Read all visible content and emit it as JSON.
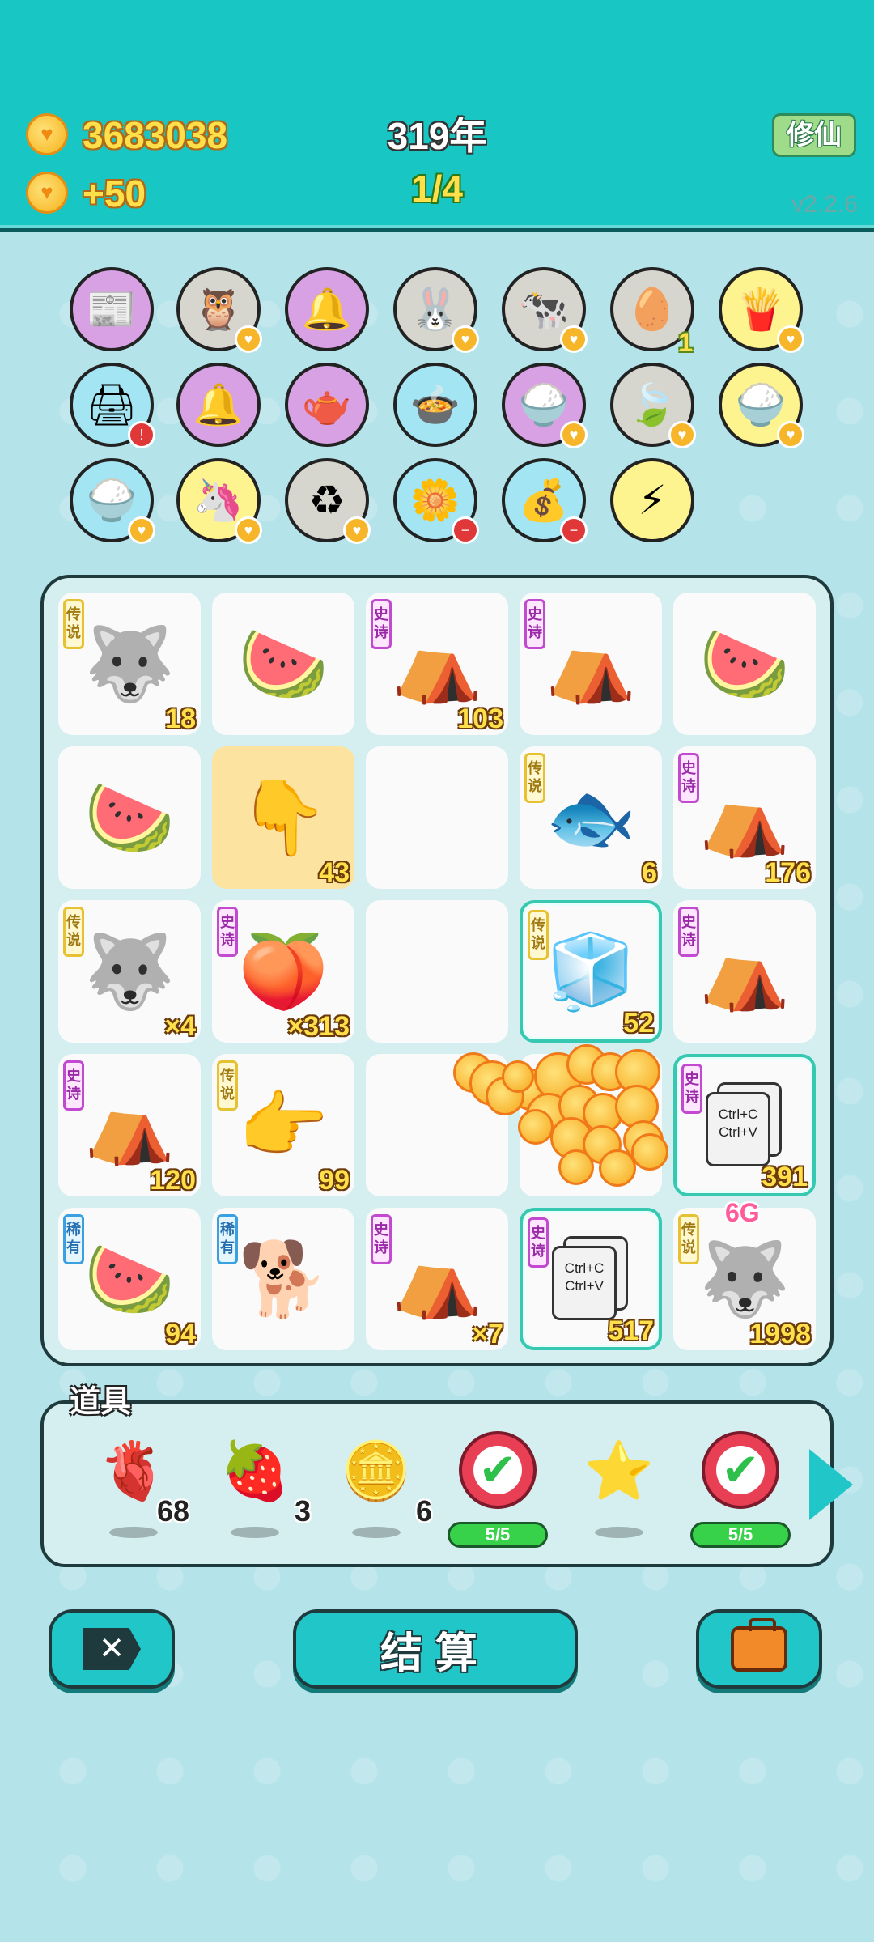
{
  "header": {
    "coins": "3683038",
    "income": "+50",
    "year": "319年",
    "progress": "1/4",
    "mode_button": "修仙",
    "version": "v2.2.6"
  },
  "buffs": [
    {
      "icon": "time-magazine-icon",
      "glyph": "📰",
      "bg": "purple",
      "badge": ""
    },
    {
      "icon": "owl-glasses-icon",
      "glyph": "🦉",
      "bg": "grey",
      "badge": "coin"
    },
    {
      "icon": "bell-icon",
      "glyph": "🔔",
      "bg": "purple",
      "badge": ""
    },
    {
      "icon": "rabbit-icon",
      "glyph": "🐰",
      "bg": "grey",
      "badge": "coin"
    },
    {
      "icon": "cows-icon",
      "glyph": "🐄",
      "bg": "grey",
      "badge": "coin"
    },
    {
      "icon": "egg-tray-icon",
      "glyph": "🥚",
      "bg": "grey",
      "badge": "",
      "count": "1"
    },
    {
      "icon": "fries-icon",
      "glyph": "🍟",
      "bg": "yellow",
      "badge": "coin"
    },
    {
      "icon": "printer-icon",
      "glyph": "🖨",
      "bg": "blue",
      "badge": "warn"
    },
    {
      "icon": "bell-icon",
      "glyph": "🔔",
      "bg": "purple",
      "badge": ""
    },
    {
      "icon": "gravy-boat-icon",
      "glyph": "🫖",
      "bg": "purple",
      "badge": ""
    },
    {
      "icon": "pot-duck-icon",
      "glyph": "🍲",
      "bg": "blue",
      "badge": ""
    },
    {
      "icon": "rice-bowl-icon",
      "glyph": "🍚",
      "bg": "purple",
      "badge": "coin"
    },
    {
      "icon": "leaf-icon",
      "glyph": "🍃",
      "bg": "grey",
      "badge": "coin"
    },
    {
      "icon": "rice-bowl-icon",
      "glyph": "🍚",
      "bg": "yellow",
      "badge": "coin"
    },
    {
      "icon": "rice-bowl-icon",
      "glyph": "🍚",
      "bg": "blue",
      "badge": "coin"
    },
    {
      "icon": "unicorn-icon",
      "glyph": "🦄",
      "bg": "yellow",
      "badge": "coin"
    },
    {
      "icon": "recycle-icon",
      "glyph": "♻",
      "bg": "grey",
      "badge": "coin"
    },
    {
      "icon": "flower-pot-icon",
      "glyph": "🌼",
      "bg": "blue",
      "badge": "minus"
    },
    {
      "icon": "money-bag-icon",
      "glyph": "💰",
      "bg": "blue",
      "badge": "minus"
    },
    {
      "icon": "lightning-icon",
      "glyph": "⚡",
      "bg": "yellow",
      "badge": ""
    }
  ],
  "board": [
    {
      "icon": "husky-crown-icon",
      "glyph": "🐺",
      "tag": "传说",
      "tag_type": "leg",
      "count": "18"
    },
    {
      "icon": "watermelon-icon",
      "glyph": "🍉",
      "tag": "",
      "count": ""
    },
    {
      "icon": "rabbit-tent-icon",
      "glyph": "⛺",
      "tag": "史诗",
      "tag_type": "epic",
      "count": "103"
    },
    {
      "icon": "rabbit-tent-icon",
      "glyph": "⛺",
      "tag": "史诗",
      "tag_type": "epic",
      "count": ""
    },
    {
      "icon": "watermelon-icon",
      "glyph": "🍉",
      "tag": "",
      "count": ""
    },
    {
      "icon": "watermelon-icon",
      "glyph": "🍉",
      "tag": "",
      "count": ""
    },
    {
      "icon": "pointing-hand-icon",
      "glyph": "👇",
      "tag": "",
      "count": "43",
      "highlight": true
    },
    {
      "icon": "empty-cell",
      "glyph": "",
      "tag": "",
      "count": ""
    },
    {
      "icon": "koi-fish-icon",
      "glyph": "🐟",
      "tag": "传说",
      "tag_type": "leg",
      "count": "6"
    },
    {
      "icon": "rabbit-tent-icon",
      "glyph": "⛺",
      "tag": "史诗",
      "tag_type": "epic",
      "count": "176"
    },
    {
      "icon": "husky-crown-icon",
      "glyph": "🐺",
      "tag": "传说",
      "tag_type": "leg",
      "count": "×4"
    },
    {
      "icon": "peach-icon",
      "glyph": "🍑",
      "tag": "史诗",
      "tag_type": "epic",
      "count": "×313"
    },
    {
      "icon": "empty-cell",
      "glyph": "",
      "tag": "",
      "count": ""
    },
    {
      "icon": "fridge-icon",
      "glyph": "🧊",
      "tag": "传说",
      "tag_type": "leg",
      "count": "52",
      "selected": true
    },
    {
      "icon": "rabbit-tent-icon",
      "glyph": "⛺",
      "tag": "史诗",
      "tag_type": "epic",
      "count": ""
    },
    {
      "icon": "rabbit-tent-icon",
      "glyph": "⛺",
      "tag": "史诗",
      "tag_type": "epic",
      "count": "120"
    },
    {
      "icon": "pointing-hand-icon",
      "glyph": "👉",
      "tag": "传说",
      "tag_type": "leg",
      "count": "99"
    },
    {
      "icon": "empty-cell",
      "glyph": "",
      "tag": "",
      "count": ""
    },
    {
      "icon": "empty-cell",
      "glyph": "",
      "tag": "",
      "count": ""
    },
    {
      "icon": "copy-paste-icon",
      "glyph": "clip",
      "tag": "史诗",
      "tag_type": "epic",
      "count": "391",
      "selected": true
    },
    {
      "icon": "watermelon-icon",
      "glyph": "🍉",
      "tag": "稀有",
      "tag_type": "rare",
      "count": "94"
    },
    {
      "icon": "husky-sitting-icon",
      "glyph": "🐕",
      "tag": "稀有",
      "tag_type": "rare",
      "count": ""
    },
    {
      "icon": "rabbit-tent-icon",
      "glyph": "⛺",
      "tag": "史诗",
      "tag_type": "epic",
      "count": "×7"
    },
    {
      "icon": "copy-paste-icon",
      "glyph": "clip",
      "tag": "史诗",
      "tag_type": "epic",
      "count": "517",
      "selected": true
    },
    {
      "icon": "husky-crown-icon",
      "glyph": "🐺",
      "tag": "传说",
      "tag_type": "leg",
      "count": "1998"
    }
  ],
  "board_extra": {
    "top_label": "6G",
    "clip_line1": "Ctrl+C",
    "clip_line2": "Ctrl+V"
  },
  "items_panel": {
    "title": "道具",
    "items": [
      {
        "icon": "liver-icon",
        "glyph": "🫀",
        "count": "68"
      },
      {
        "icon": "lychee-icon",
        "glyph": "🍓",
        "count": "3"
      },
      {
        "icon": "dollar-coin-icon",
        "glyph": "🪙",
        "count": "6"
      },
      {
        "icon": "check-icon",
        "glyph": "check",
        "pill": "5/5"
      },
      {
        "icon": "star-icon",
        "glyph": "⭐",
        "count": ""
      },
      {
        "icon": "check-icon",
        "glyph": "check",
        "pill": "5/5"
      }
    ]
  },
  "bottom": {
    "settle_label": "结算"
  }
}
